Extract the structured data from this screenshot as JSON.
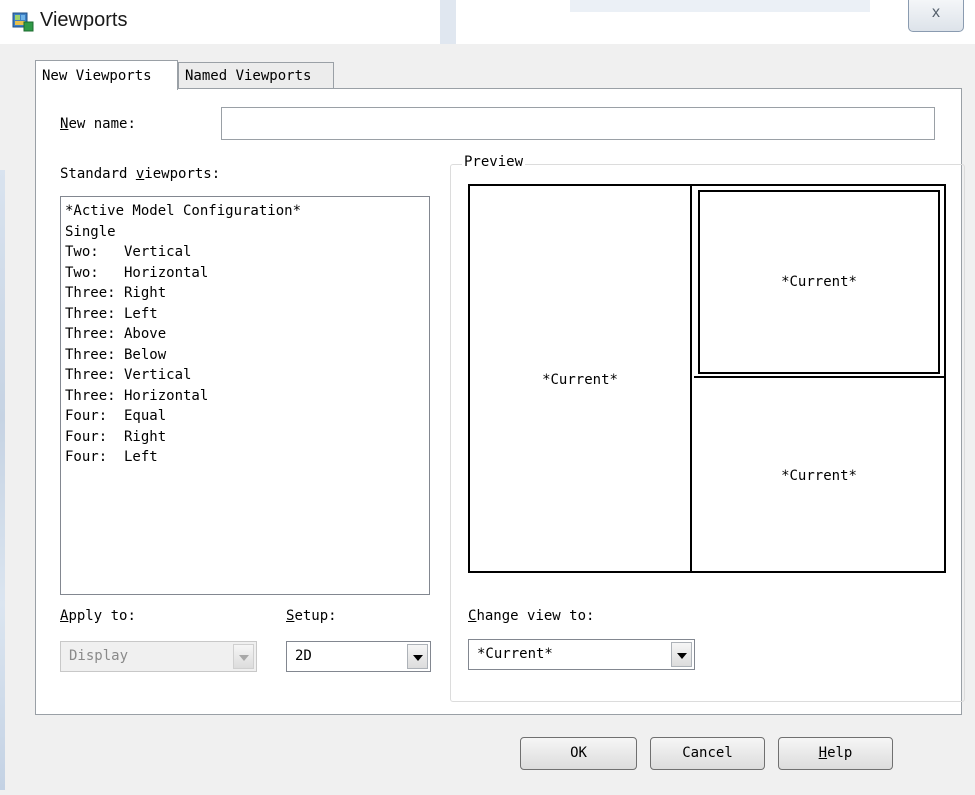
{
  "window": {
    "title": "Viewports",
    "close_glyph": "x",
    "icon": "viewports-app-icon"
  },
  "tabs": [
    {
      "label": "New Viewports",
      "active": true
    },
    {
      "label": "Named Viewports",
      "active": false
    }
  ],
  "new_name": {
    "label_first": "N",
    "label_rest": "ew name:",
    "value": ""
  },
  "standard": {
    "label_pre": "Standard ",
    "label_ul": "v",
    "label_post": "iewports:",
    "items": [
      "*Active Model Configuration*",
      "Single",
      "Two:   Vertical",
      "Two:   Horizontal",
      "Three: Right",
      "Three: Left",
      "Three: Above",
      "Three: Below",
      "Three: Vertical",
      "Three: Horizontal",
      "Four:  Equal",
      "Four:  Right",
      "Four:  Left"
    ]
  },
  "preview": {
    "title": "Preview",
    "panes": {
      "left": "*Current*",
      "top_right": "*Current*",
      "bottom_right": "*Current*"
    }
  },
  "apply_to": {
    "label_first": "A",
    "label_rest": "pply to:",
    "value": "Display",
    "enabled": false
  },
  "setup": {
    "label_first": "S",
    "label_rest": "etup:",
    "value": "2D"
  },
  "change_view": {
    "label_first": "C",
    "label_rest": "hange view to:",
    "value": "*Current*"
  },
  "buttons": {
    "ok": "OK",
    "cancel": "Cancel",
    "help_first": "H",
    "help_rest": "elp"
  },
  "colors": {
    "dialog_bg": "#f0f0f0",
    "panel_bg": "#ffffff",
    "border": "#9aa0a6"
  }
}
